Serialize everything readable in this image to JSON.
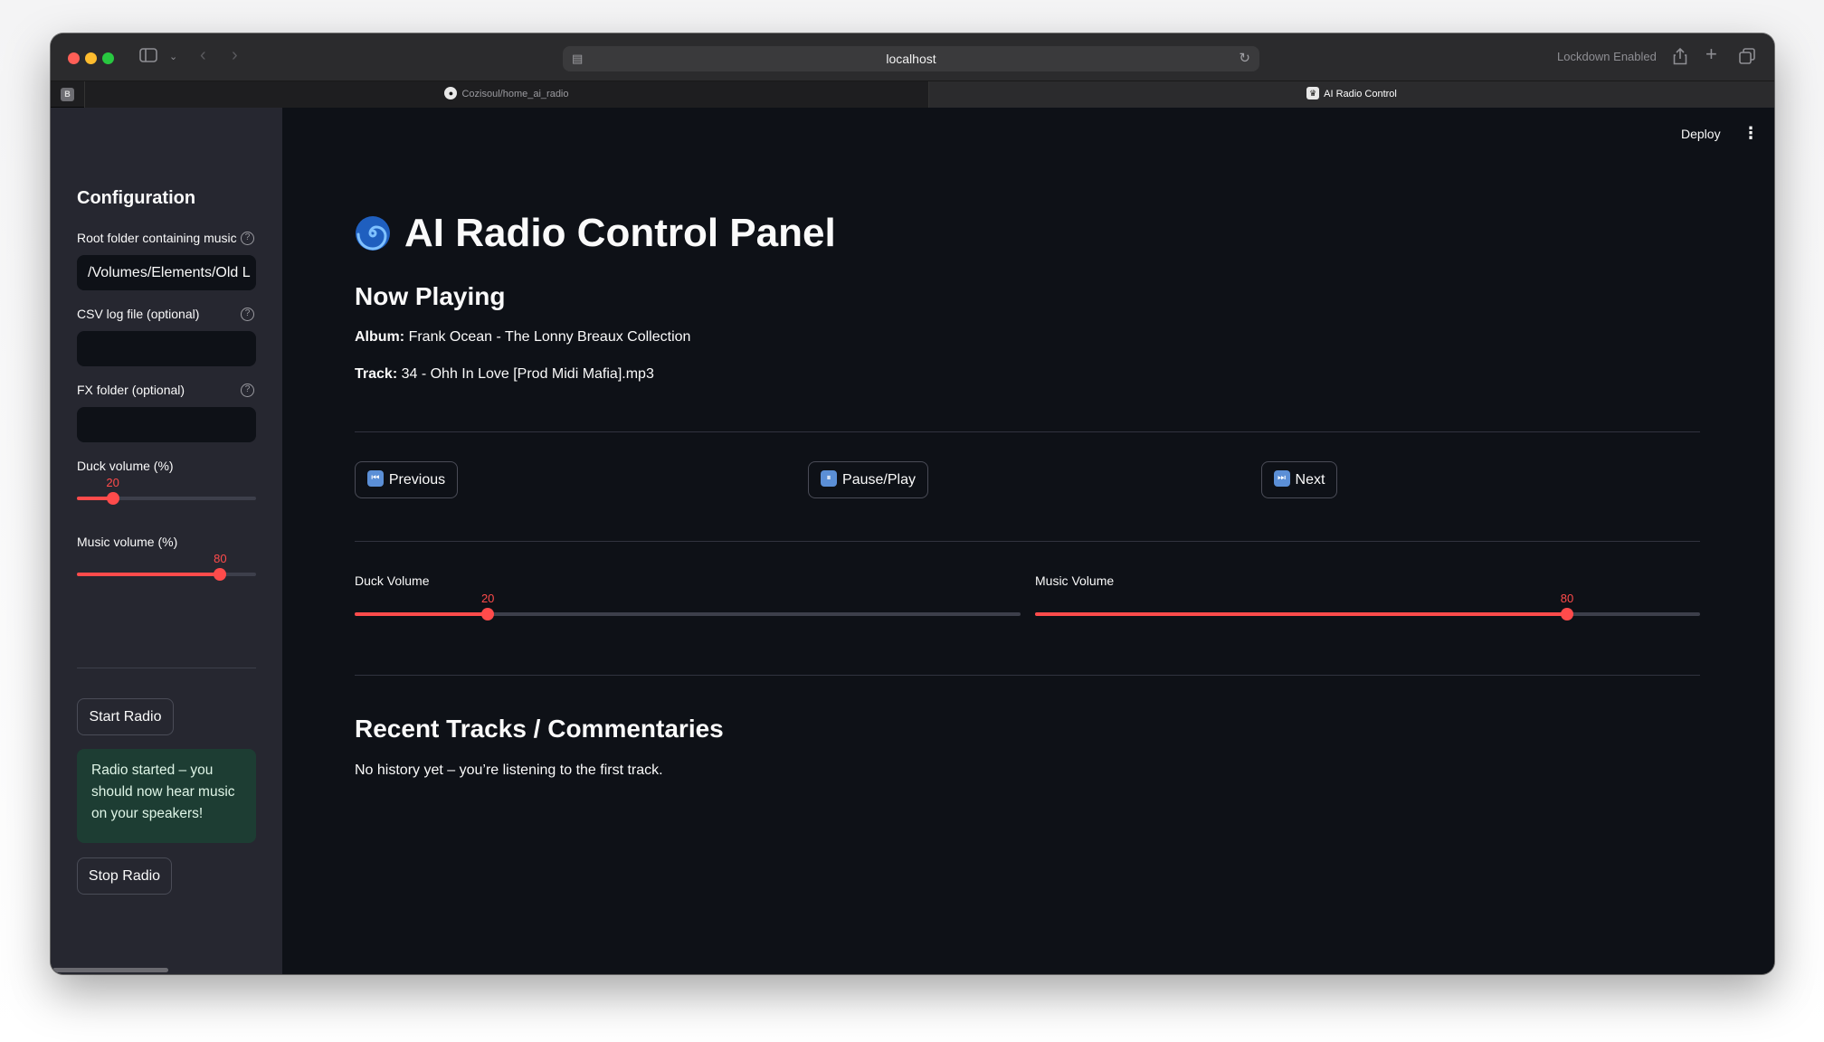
{
  "browser": {
    "url": "localhost",
    "lockdown_text": "Lockdown Enabled",
    "tabs": [
      {
        "label": "Cozisoul/home_ai_radio",
        "active": false
      },
      {
        "label": "AI Radio Control",
        "active": true
      }
    ]
  },
  "header": {
    "deploy_label": "Deploy"
  },
  "sidebar": {
    "title": "Configuration",
    "root_folder": {
      "label": "Root folder containing music",
      "value": "/Volumes/Elements/Old L"
    },
    "csv_log": {
      "label": "CSV log file (optional)",
      "value": ""
    },
    "fx_folder": {
      "label": "FX folder (optional)",
      "value": ""
    },
    "duck_volume": {
      "label": "Duck volume (%)",
      "value": "20",
      "fraction": 0.2
    },
    "music_volume": {
      "label": "Music volume (%)",
      "value": "80",
      "fraction": 0.8
    },
    "start_button": "Start Radio",
    "success_message": "Radio started – you should now hear music on your speakers!",
    "stop_button": "Stop Radio"
  },
  "main": {
    "title": "AI Radio Control Panel",
    "now_playing_heading": "Now Playing",
    "album_label": "Album:",
    "album_value": "Frank Ocean - The Lonny Breaux Collection",
    "track_label": "Track:",
    "track_value": "34 - Ohh In Love [Prod Midi Mafia].mp3",
    "controls": {
      "previous": "Previous",
      "pause_play": "Pause/Play",
      "next": "Next"
    },
    "duck_volume": {
      "label": "Duck Volume",
      "value": "20",
      "fraction": 0.2
    },
    "music_volume": {
      "label": "Music Volume",
      "value": "80",
      "fraction": 0.8
    },
    "recent_heading": "Recent Tracks / Commentaries",
    "recent_empty": "No history yet – you’re listening to the first track."
  },
  "colors": {
    "accent": "#ff4b4b",
    "background": "#0e1117",
    "sidebar": "#262730",
    "success_bg": "#1d3d33"
  }
}
